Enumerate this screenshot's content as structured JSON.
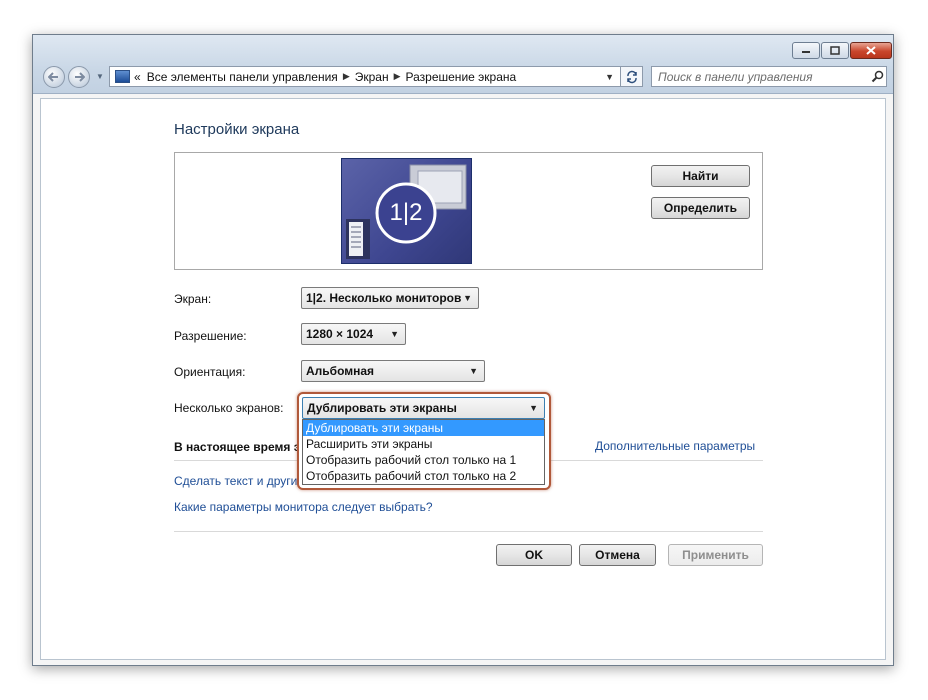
{
  "address_bar": {
    "overflow_marker": "«",
    "breadcrumbs": [
      "Все элементы панели управления",
      "Экран",
      "Разрешение экрана"
    ],
    "separator": "▶",
    "dropdown_glyph": "▼"
  },
  "search": {
    "placeholder": "Поиск в панели управления"
  },
  "page": {
    "title": "Настройки экрана"
  },
  "monitor_panel": {
    "monitor_label": "1|2",
    "find_button": "Найти",
    "identify_button": "Определить"
  },
  "settings": {
    "display_label": "Экран:",
    "display_value": "1|2. Несколько мониторов",
    "resolution_label": "Разрешение:",
    "resolution_value": "1280 × 1024",
    "orientation_label": "Ориентация:",
    "orientation_value": "Альбомная",
    "multiple_label": "Несколько экранов:",
    "multiple_value": "Дублировать эти экраны",
    "multiple_options": [
      "Дублировать эти экраны",
      "Расширить эти экраны",
      "Отобразить рабочий стол только на 1",
      "Отобразить рабочий стол только на 2"
    ],
    "multiple_selected_index": 0
  },
  "info": {
    "current_text_partial": "В настоящее время э",
    "advanced_link": "Дополнительные параметры",
    "text_size_link_partial": "Сделать текст и други",
    "monitor_help_link": "Какие параметры монитора следует выбрать?"
  },
  "buttons": {
    "ok": "OK",
    "cancel": "Отмена",
    "apply": "Применить"
  },
  "icons": {
    "nav_back": "back-arrow-icon",
    "nav_forward": "forward-arrow-icon",
    "refresh": "refresh-icon",
    "search": "search-icon",
    "control_panel": "control-panel-icon"
  },
  "colors": {
    "selection": "#3399ff",
    "highlight_border": "#b0593a",
    "link": "#1f4e96",
    "title": "#1e395b"
  }
}
